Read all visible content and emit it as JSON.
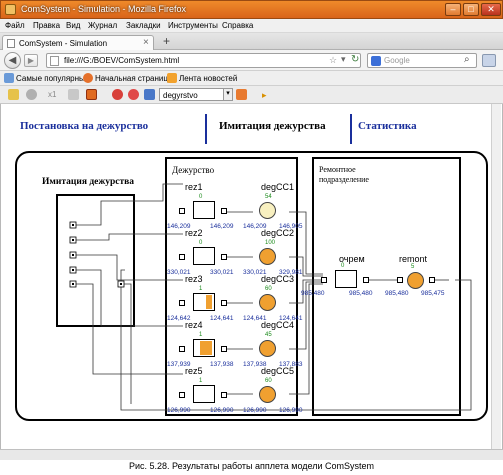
{
  "window": {
    "title": "ComSystem - Simulation - Mozilla Firefox",
    "min": "–",
    "max": "□",
    "close": "✕"
  },
  "menu": [
    "Файл",
    "Правка",
    "Вид",
    "Журнал",
    "Закладки",
    "Инструменты",
    "Справка"
  ],
  "tab": {
    "label": "ComSystem - Simulation",
    "close": "×",
    "new": "+"
  },
  "address": {
    "url": "file:///G:/BOEV/ComSystem.html",
    "search_placeholder": "Google"
  },
  "bookmarks": [
    "Самые популярные",
    "Начальная страница",
    "Лента новостей"
  ],
  "toolbar2": {
    "search_value": "degyrstvo",
    "counter": "x1"
  },
  "page": {
    "nav": [
      "Постановка на дежурство",
      "Имитация дежурства",
      "Статистика"
    ],
    "left_title": "Имитация дежурства",
    "duty_title": "Дежурство",
    "repair_title_1": "Ремонтное",
    "repair_title_2": "подразделение",
    "rows": [
      {
        "rez": "rez1",
        "bar": "0",
        "rez_in": "146,209",
        "rez_out": "146,209",
        "deg": "degCC1",
        "deg_val": "54",
        "deg_in": "146,209",
        "deg_out": "146,905",
        "busy": false
      },
      {
        "rez": "rez2",
        "bar": "0",
        "rez_in": "330,021",
        "rez_out": "330,021",
        "deg": "degCC2",
        "deg_val": "100",
        "deg_in": "330,021",
        "deg_out": "329,981",
        "busy": true
      },
      {
        "rez": "rez3",
        "bar": "1",
        "rez_in": "124,642",
        "rez_out": "124,641",
        "deg": "degCC3",
        "deg_val": "60",
        "deg_in": "124,641",
        "deg_out": "124,641",
        "busy": true
      },
      {
        "rez": "rez4",
        "bar": "1",
        "rez_in": "137,939",
        "rez_out": "137,938",
        "deg": "degCC4",
        "deg_val": "45",
        "deg_in": "137,938",
        "deg_out": "137,883",
        "busy": true
      },
      {
        "rez": "rez5",
        "bar": "1",
        "rez_in": "126,990",
        "rez_out": "126,990",
        "deg": "degCC5",
        "deg_val": "60",
        "deg_in": "126,990",
        "deg_out": "126,990",
        "busy": true
      }
    ],
    "queue": {
      "label": "очрем",
      "bar": "0",
      "in": "985,480",
      "out": "985,480"
    },
    "remont": {
      "label": "remont",
      "val": "5",
      "in": "985,480",
      "out": "985,475"
    },
    "left_in": "985,480"
  },
  "caption": "Рис. 5.28. Результаты работы апплета модели ComSystem",
  "colors": {
    "accent": "#1a2f9c",
    "busy": "#f0a030",
    "idle": "#f8f0c0",
    "title_bg": "#d9641a"
  }
}
